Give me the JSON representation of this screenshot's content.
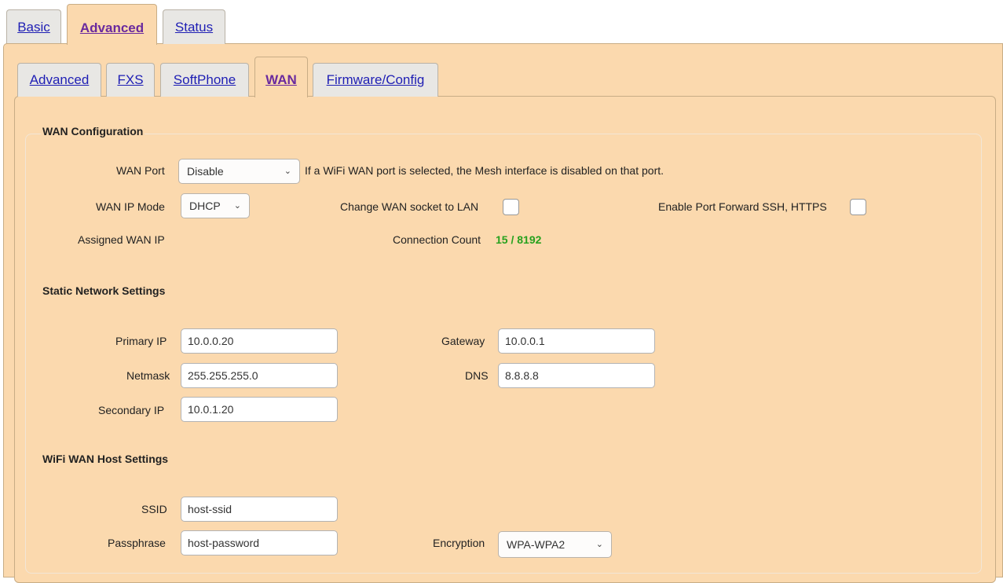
{
  "top_tabs": [
    {
      "label": "Basic",
      "active": false
    },
    {
      "label": "Advanced",
      "active": true
    },
    {
      "label": "Status",
      "active": false
    }
  ],
  "sub_tabs": [
    {
      "label": "Advanced",
      "active": false
    },
    {
      "label": "FXS",
      "active": false
    },
    {
      "label": "SoftPhone",
      "active": false
    },
    {
      "label": "WAN",
      "active": true
    },
    {
      "label": "Firmware/Config",
      "active": false
    }
  ],
  "wan_config": {
    "title": "WAN Configuration",
    "wan_port_label": "WAN Port",
    "wan_port_value": "Disable",
    "wan_port_note": "If a WiFi WAN port is selected, the Mesh interface is disabled on that port.",
    "ip_mode_label": "WAN IP Mode",
    "ip_mode_value": "DHCP",
    "change_socket_label": "Change WAN socket to LAN",
    "change_socket_checked": false,
    "port_forward_label": "Enable Port Forward SSH, HTTPS",
    "port_forward_checked": false,
    "assigned_ip_label": "Assigned WAN IP",
    "connection_count_label": "Connection Count",
    "connection_count_value": "15 / 8192"
  },
  "static_settings": {
    "title": "Static Network Settings",
    "primary_ip_label": "Primary IP",
    "primary_ip_value": "10.0.0.20",
    "gateway_label": "Gateway",
    "gateway_value": "10.0.0.1",
    "netmask_label": "Netmask",
    "netmask_value": "255.255.255.0",
    "dns_label": "DNS",
    "dns_value": "8.8.8.8",
    "secondary_ip_label": "Secondary IP",
    "secondary_ip_value": "10.0.1.20"
  },
  "wifi_wan": {
    "title": "WiFi WAN Host Settings",
    "ssid_label": "SSID",
    "ssid_value": "host-ssid",
    "passphrase_label": "Passphrase",
    "passphrase_value": "host-password",
    "encryption_label": "Encryption",
    "encryption_value": "WPA-WPA2"
  },
  "colors": {
    "panel": "#fbd9ae",
    "link": "#1e1eb4",
    "active_link": "#6a2a9e",
    "count": "#27a11e"
  }
}
